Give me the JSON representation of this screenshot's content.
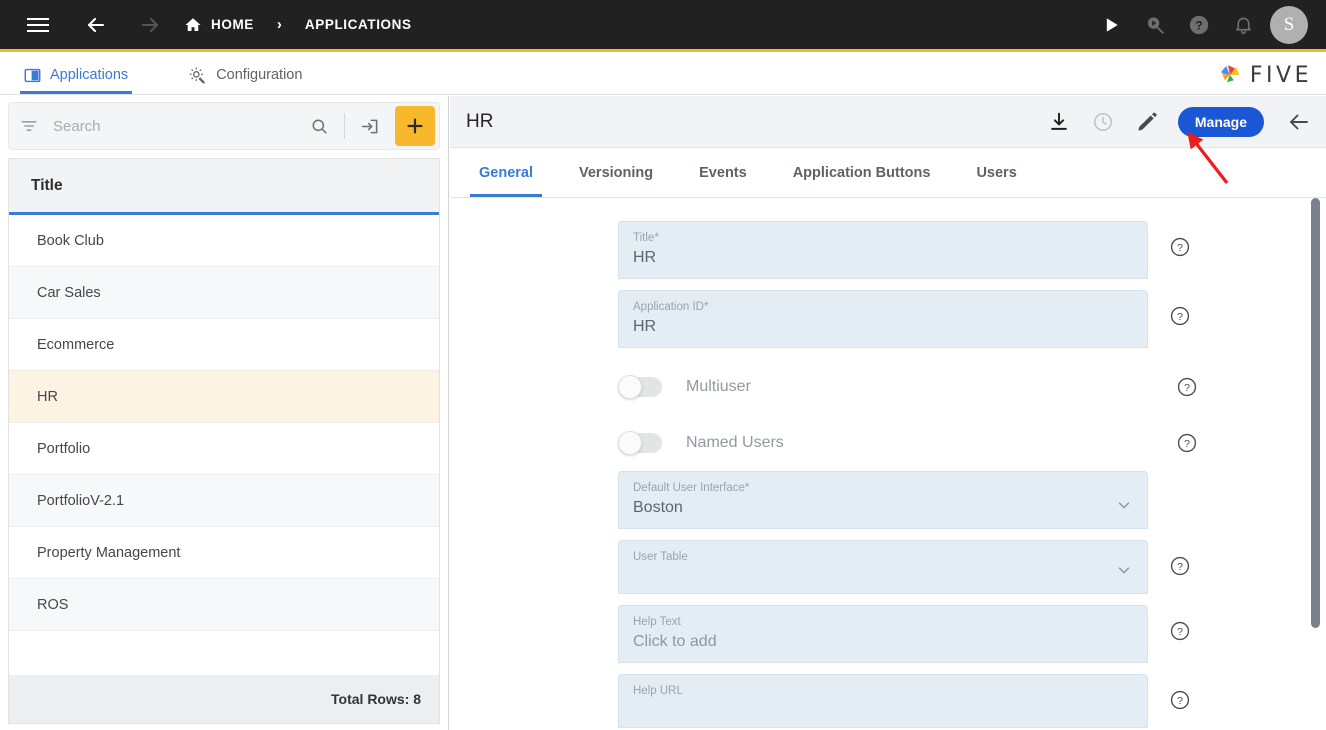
{
  "topbar": {
    "menu_icon": "hamburger-icon",
    "back_icon": "arrow-left-icon",
    "forward_icon": "arrow-right-icon",
    "home_icon": "home-icon",
    "breadcrumb": [
      {
        "label": "HOME"
      },
      {
        "label": "APPLICATIONS"
      }
    ],
    "separator": "›",
    "actions": [
      {
        "name": "run-icon",
        "title": "Run"
      },
      {
        "name": "debug-search-icon",
        "title": "Debug"
      },
      {
        "name": "help-circle-icon",
        "title": "Help"
      },
      {
        "name": "bell-icon",
        "title": "Notifications"
      }
    ],
    "avatar_initial": "S",
    "accent_bar_color": "#f5b731",
    "background": "#212121"
  },
  "subbar": {
    "tabs": [
      {
        "label": "Applications",
        "icon": "panel-split-icon",
        "active": true
      },
      {
        "label": "Configuration",
        "icon": "gear-wrench-icon",
        "active": false
      }
    ],
    "brand": "FIVE"
  },
  "left_panel": {
    "search": {
      "placeholder": "Search",
      "value": "",
      "filter_icon": "filter-icon",
      "search_icon": "search-icon",
      "import_icon": "import-icon",
      "add_label": "+",
      "add_color": "#f7b82b"
    },
    "column_header": "Title",
    "rows": [
      {
        "title": "Book Club"
      },
      {
        "title": "Car Sales"
      },
      {
        "title": "Ecommerce"
      },
      {
        "title": "HR"
      },
      {
        "title": "Portfolio"
      },
      {
        "title": "PortfolioV-2.1"
      },
      {
        "title": "Property Management"
      },
      {
        "title": "ROS"
      }
    ],
    "selected_row": "HR",
    "selected_row_color": "#fdf3e3",
    "footer": "Total Rows: 8"
  },
  "detail_panel": {
    "title": "HR",
    "header_actions": [
      {
        "name": "download-icon",
        "state": "enabled"
      },
      {
        "name": "history-clock-icon",
        "state": "disabled"
      },
      {
        "name": "edit-pencil-icon",
        "state": "enabled"
      }
    ],
    "manage_label": "Manage",
    "manage_color": "#1a56d6",
    "back_icon": "arrow-left-icon",
    "tabs": [
      {
        "label": "General",
        "active": true
      },
      {
        "label": "Versioning",
        "active": false
      },
      {
        "label": "Events",
        "active": false
      },
      {
        "label": "Application Buttons",
        "active": false
      },
      {
        "label": "Users",
        "active": false
      }
    ],
    "fields": [
      {
        "kind": "text",
        "label": "Title",
        "required": true,
        "value": "HR",
        "help": true
      },
      {
        "kind": "text",
        "label": "Application ID",
        "required": true,
        "value": "HR",
        "help": true
      },
      {
        "kind": "toggle",
        "label": "Multiuser",
        "value": "off",
        "help": true
      },
      {
        "kind": "toggle",
        "label": "Named Users",
        "value": "off",
        "help": true
      },
      {
        "kind": "select",
        "label": "Default User Interface",
        "required": true,
        "value": "Boston",
        "help": false
      },
      {
        "kind": "select",
        "label": "User Table",
        "required": false,
        "value": "",
        "help": true
      },
      {
        "kind": "text",
        "label": "Help Text",
        "required": false,
        "value": "Click to add",
        "value_is_placeholder": true,
        "help": true
      },
      {
        "kind": "text",
        "label": "Help URL",
        "required": false,
        "value": "",
        "help": true
      }
    ],
    "required_marker": "*",
    "scrollbar": {
      "visible": true,
      "thumb_color": "#7b818c"
    }
  },
  "annotation": {
    "type": "red-arrow",
    "color": "#ee1c1c",
    "points_to": "Manage"
  }
}
